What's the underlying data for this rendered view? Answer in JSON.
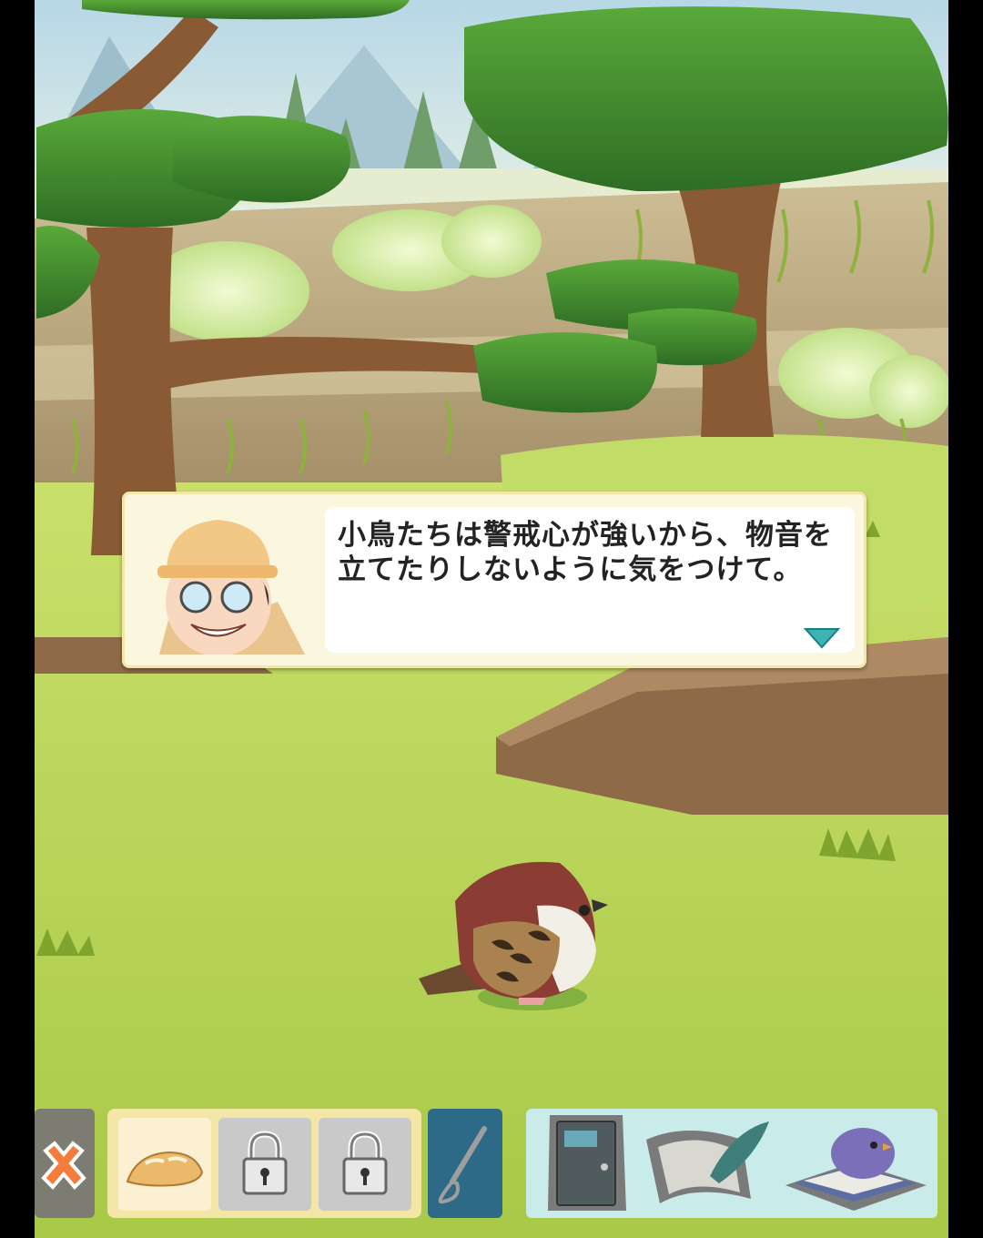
{
  "dialog": {
    "speaker_icon": "zookeeper-portrait",
    "text": "小鳥たちは警戒心が強いから、物音を立てたりしないように気をつけて。",
    "next_icon": "chevron-down-icon"
  },
  "toolbar": {
    "close_icon": "close-x-icon",
    "items": [
      {
        "icon": "bread-icon",
        "locked": false,
        "selected": true
      },
      {
        "icon": "padlock-icon",
        "locked": true
      },
      {
        "icon": "padlock-icon",
        "locked": true
      }
    ],
    "tool_icon": "whisk-icon",
    "menu": [
      {
        "icon": "door-exit-icon"
      },
      {
        "icon": "quill-memo-icon"
      },
      {
        "icon": "bird-encyclopedia-icon"
      }
    ]
  },
  "scene": {
    "character": "sparrow",
    "colors": {
      "sky": "#cfe6ef",
      "grass": "#b5d24c",
      "wall": "#c7b68c",
      "leaf": "#3d8a2c",
      "trunk": "#8a5a35"
    }
  }
}
